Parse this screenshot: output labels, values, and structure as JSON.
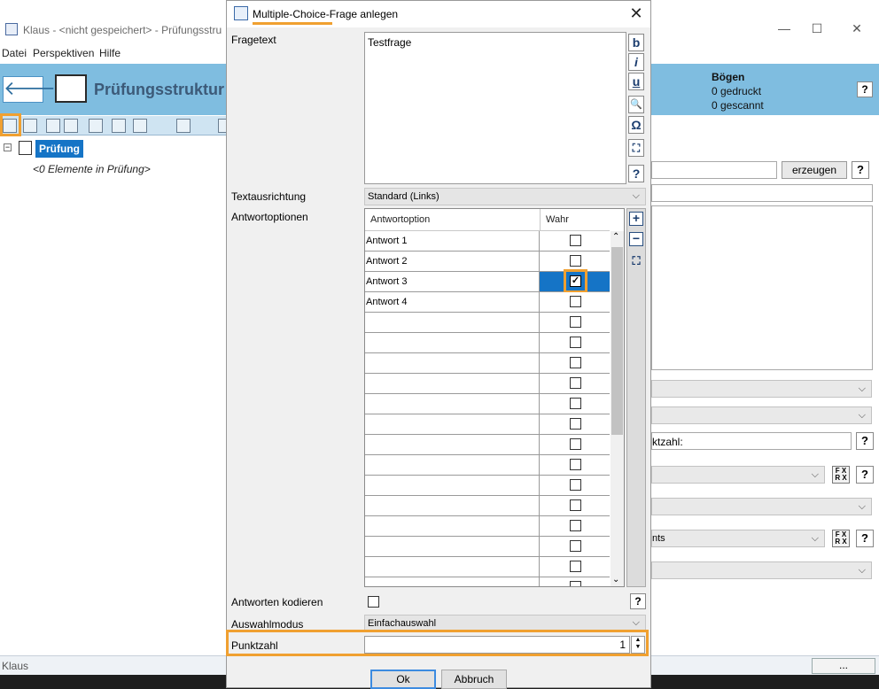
{
  "app": {
    "window_title": "Klaus - <nicht gespeichert> - Prüfungsstru",
    "menu": [
      "Datei",
      "Perspektiven",
      "Hilfe"
    ],
    "header_title": "Prüfungsstruktur",
    "boegen": {
      "label": "Bögen",
      "printed": "0 gedruckt",
      "scanned": "0 gescannt"
    },
    "help": "?",
    "tree": {
      "root": "Prüfung",
      "empty": "<0 Elemente in Prüfung>"
    },
    "status_text": "Klaus",
    "status_button": "...",
    "right_panel": {
      "generate_button": "erzeugen",
      "field_label_fragment": "ktzahl:",
      "select_fragment": "nts",
      "fx_label": "F X\nR X"
    }
  },
  "dialog": {
    "title": "Multiple-Choice-Frage anlegen",
    "close": "✕",
    "labels": {
      "fragetext": "Fragetext",
      "textausrichtung": "Textausrichtung",
      "antwortoptionen": "Antwortoptionen",
      "antworten_kodieren": "Antworten kodieren",
      "auswahlmodus": "Auswahlmodus",
      "punktzahl": "Punktzahl"
    },
    "fragetext_value": "Testfrage",
    "format_buttons": [
      "b",
      "i",
      "u",
      "🔍",
      "Ω",
      "⛶",
      "?"
    ],
    "textausrichtung_value": "Standard (Links)",
    "grid": {
      "headers": [
        "Antwortoption",
        "Wahr"
      ],
      "rows": [
        {
          "text": "Antwort 1",
          "checked": false
        },
        {
          "text": "Antwort 2",
          "checked": false
        },
        {
          "text": "Antwort 3",
          "checked": true
        },
        {
          "text": "Antwort 4",
          "checked": false
        },
        {
          "text": "",
          "checked": false
        },
        {
          "text": "",
          "checked": false
        },
        {
          "text": "",
          "checked": false
        },
        {
          "text": "",
          "checked": false
        },
        {
          "text": "",
          "checked": false
        },
        {
          "text": "",
          "checked": false
        },
        {
          "text": "",
          "checked": false
        },
        {
          "text": "",
          "checked": false
        },
        {
          "text": "",
          "checked": false
        },
        {
          "text": "",
          "checked": false
        },
        {
          "text": "",
          "checked": false
        },
        {
          "text": "",
          "checked": false
        },
        {
          "text": "",
          "checked": false
        },
        {
          "text": "",
          "checked": false
        }
      ]
    },
    "auswahlmodus_value": "Einfachauswahl",
    "punktzahl_value": "1",
    "help": "?",
    "ok": "Ok",
    "cancel": "Abbruch"
  }
}
